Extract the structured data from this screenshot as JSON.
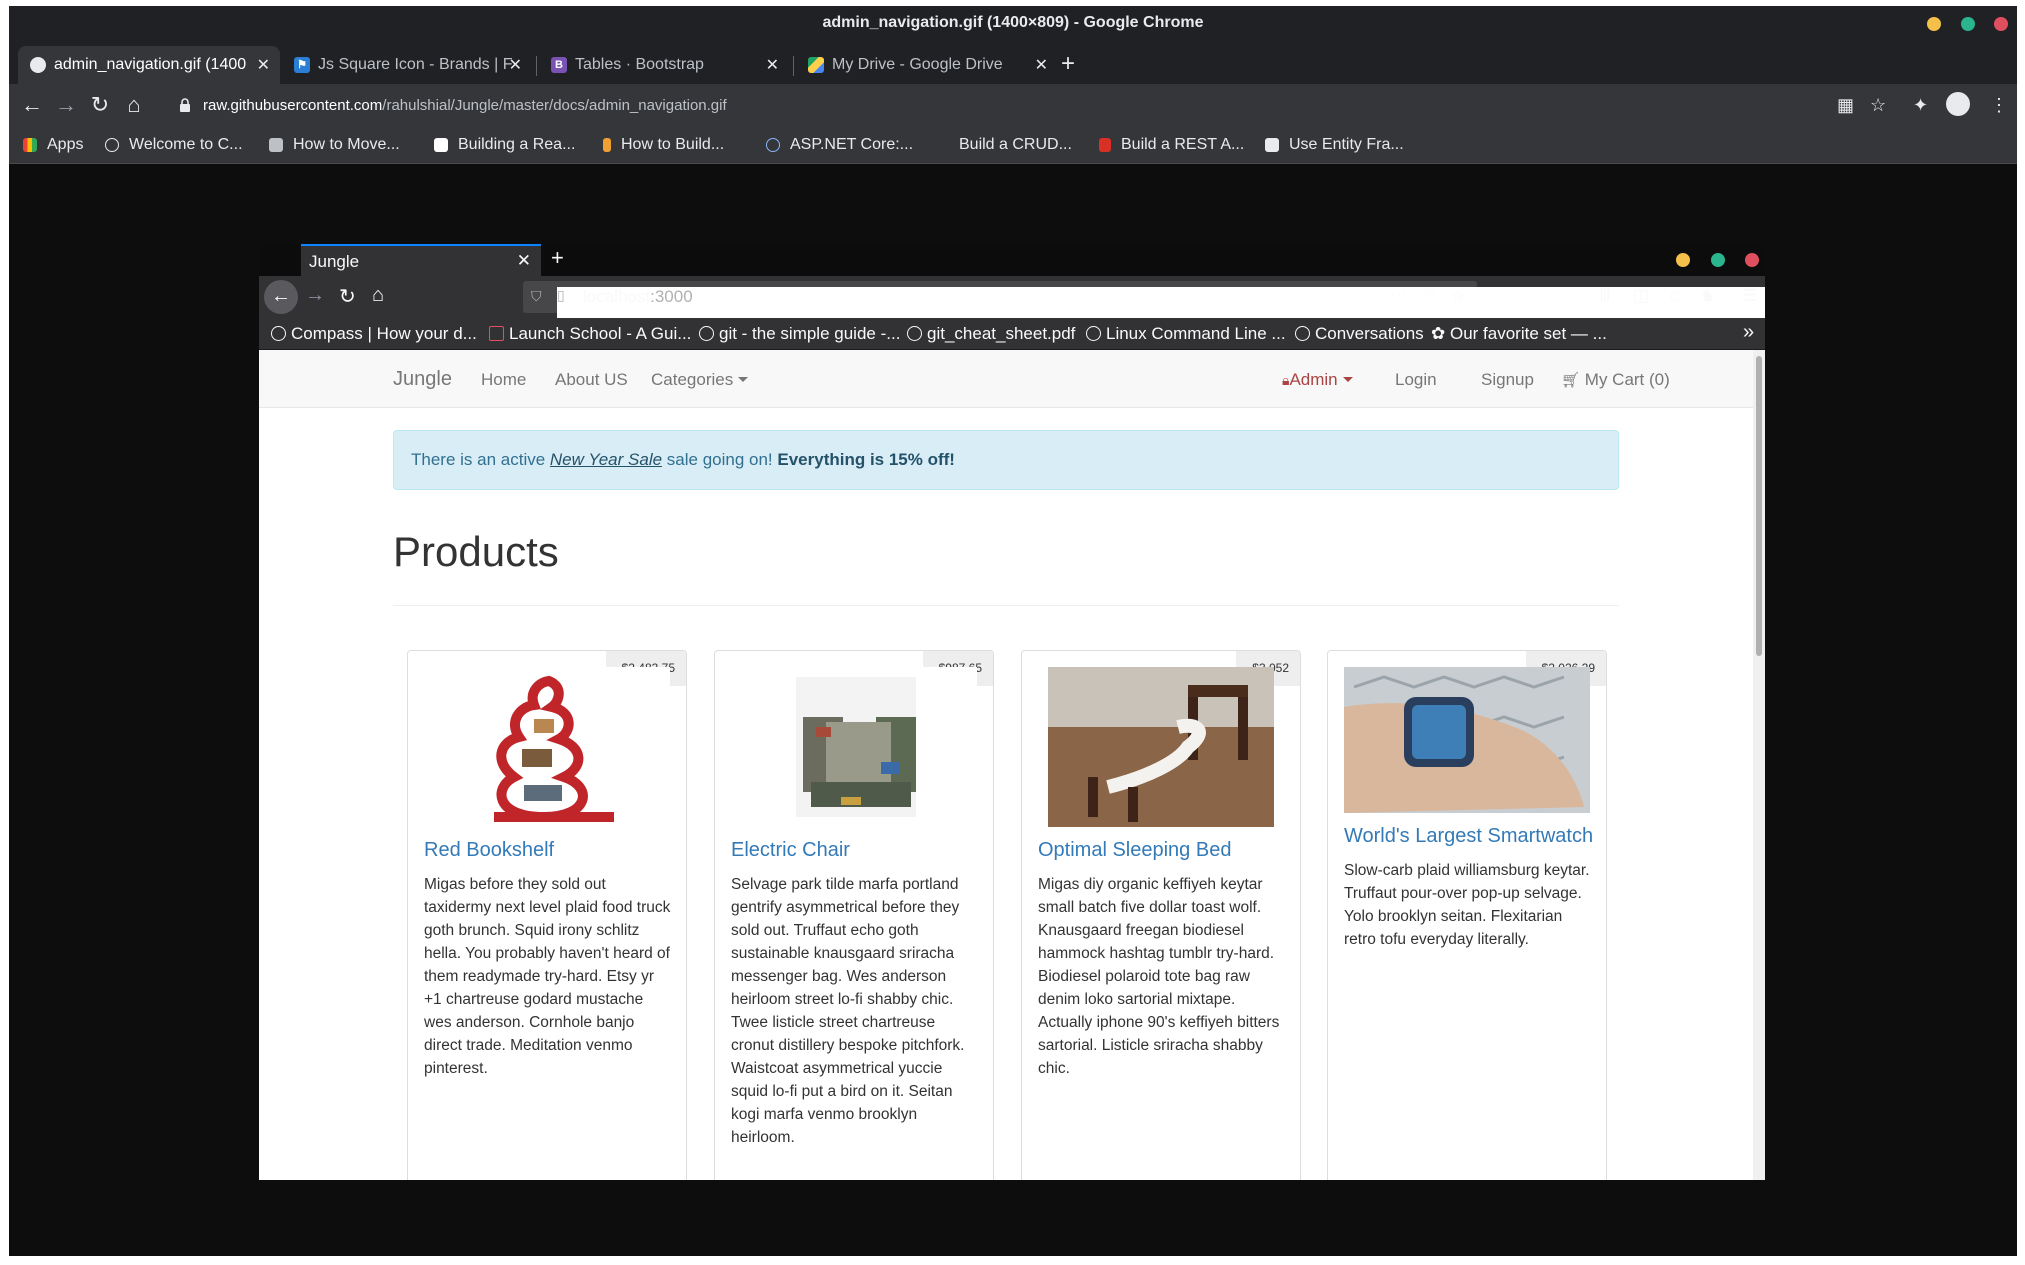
{
  "chrome": {
    "title": "admin_navigation.gif (1400×809) - Google Chrome",
    "tabs": [
      {
        "label": "admin_navigation.gif (1400",
        "active": true
      },
      {
        "label": "Js Square Icon - Brands | F",
        "active": false
      },
      {
        "label": "Tables · Bootstrap",
        "active": false
      },
      {
        "label": "My Drive - Google Drive",
        "active": false
      }
    ],
    "url_host": "raw.githubusercontent.com",
    "url_path": "/rahulshial/Jungle/master/docs/admin_navigation.gif",
    "bookmarks": [
      "Apps",
      "Welcome to C...",
      "How to Move...",
      "Building a Rea...",
      "How to Build...",
      "ASP.NET Core:...",
      "Build a CRUD...",
      "Build a REST A...",
      "Use Entity Fra..."
    ]
  },
  "firefox": {
    "tab_label": "Jungle",
    "url_host": "localhost",
    "url_port": ":3000",
    "bookmarks": [
      "Compass | How your d...",
      "Launch School - A Gui...",
      "git - the simple guide -...",
      "git_cheat_sheet.pdf",
      "Linux Command Line ...",
      "Conversations",
      "✿ Our favorite set — ..."
    ]
  },
  "site": {
    "brand": "Jungle",
    "nav_left": [
      "Home",
      "About US",
      "Categories"
    ],
    "nav_right": {
      "admin": "Admin",
      "login": "Login",
      "signup": "Signup",
      "cart": "My Cart (0)"
    },
    "alert": {
      "prefix": "There is an active ",
      "sale_link": "New Year Sale",
      "middle": " sale going on! ",
      "bold": "Everything is 15% off!"
    },
    "heading": "Products",
    "products": [
      {
        "name": "Red Bookshelf",
        "price": "$2,483.75",
        "description": "Migas before they sold out taxidermy next level plaid food truck goth brunch. Squid irony schlitz hella. You probably haven't heard of them readymade try-hard. Etsy yr +1 chartreuse godard mustache wes anderson. Cornhole banjo direct trade. Meditation venmo pinterest."
      },
      {
        "name": "Electric Chair",
        "price": "$987.65",
        "description": "Selvage park tilde marfa portland gentrify asymmetrical before they sold out. Truffaut echo goth sustainable knausgaard sriracha messenger bag. Wes anderson heirloom street lo-fi shabby chic. Twee listicle street chartreuse cronut distillery bespoke pitchfork. Waistcoat asymmetrical yuccie squid lo-fi put a bird on it. Seitan kogi marfa venmo brooklyn heirloom."
      },
      {
        "name": "Optimal Sleeping Bed",
        "price": "$3,052",
        "description": "Migas diy organic keffiyeh keytar small batch five dollar toast wolf. Knausgaard freegan biodiesel hammock hashtag tumblr try-hard. Biodiesel polaroid tote bag raw denim loko sartorial mixtape. Actually iphone 90's keffiyeh bitters sartorial. Listicle sriracha shabby chic."
      },
      {
        "name": "World's Largest Smartwatch",
        "price": "$2,026.29",
        "description": "Slow-carb plaid williamsburg keytar. Truffaut pour-over pop-up selvage. Yolo brooklyn seitan. Flexitarian retro tofu everyday literally."
      }
    ]
  },
  "colors": {
    "link": "#337ab7",
    "alert_bg": "#d9edf7",
    "alert_text": "#31708f",
    "admin": "#a94442"
  },
  "icons": [
    "chrome-icon",
    "flag-icon",
    "bootstrap-icon",
    "drive-icon",
    "lock-icon",
    "star-icon",
    "puzzle-icon",
    "profile-icon",
    "menu-icon",
    "shield-icon",
    "library-icon",
    "sidebar-icon",
    "hamburger-icon",
    "cart-icon",
    "padlock-icon"
  ]
}
